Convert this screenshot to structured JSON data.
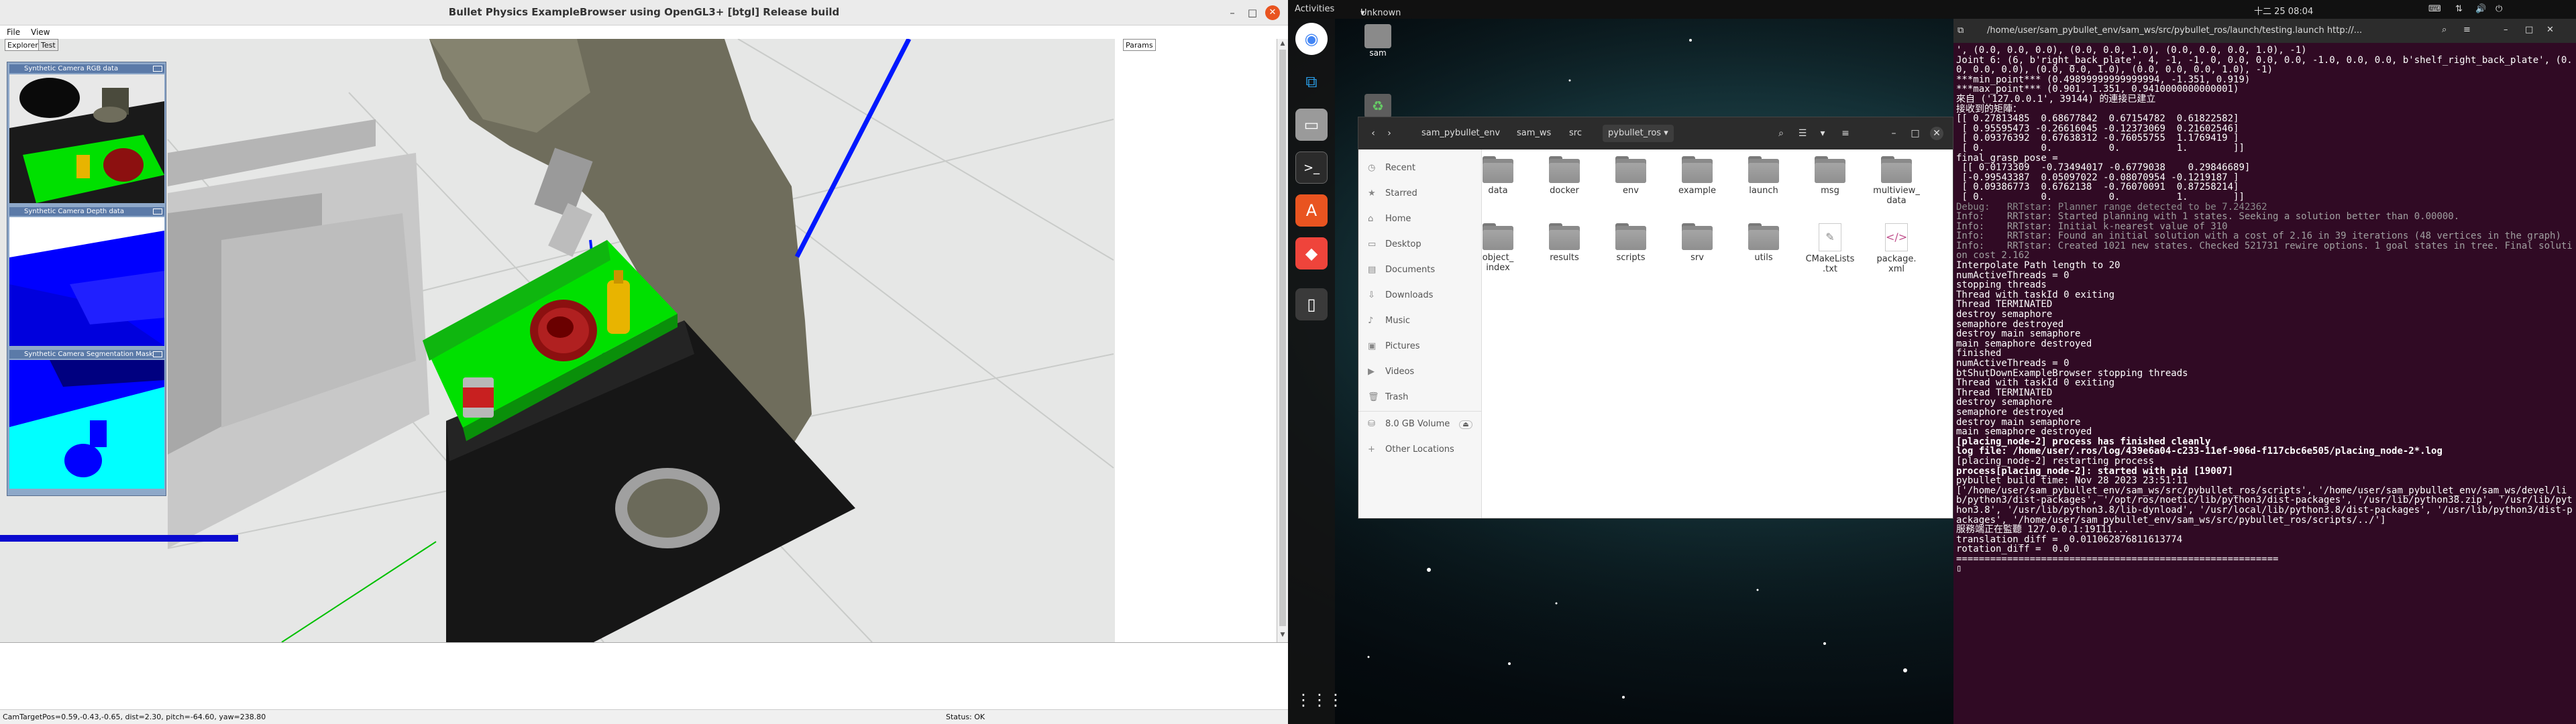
{
  "bullet": {
    "title": "Bullet Physics ExampleBrowser using OpenGL3+ [btgl] Release build",
    "menu": [
      "File",
      "View"
    ],
    "tabs": [
      "Explorer",
      "Test"
    ],
    "params_tab": "Params",
    "camera_panels": [
      "Synthetic Camera RGB data",
      "Synthetic Camera Depth data",
      "Synthetic Camera Segmentation Mask"
    ],
    "status_left": "CamTargetPos=0.59,-0.43,-0.65, dist=2.30, pitch=-64.60, yaw=238.80",
    "status_right": "Status: OK"
  },
  "topbar": {
    "activities": "Activities",
    "app_menu": "Unknown",
    "clock": "十二 25 08:04"
  },
  "dock": [
    {
      "name": "chrome",
      "icon": "chrome-icon"
    },
    {
      "name": "vscode",
      "icon": "vscode-icon"
    },
    {
      "name": "files",
      "icon": "files-icon"
    },
    {
      "name": "terminal",
      "icon": "terminal-icon"
    },
    {
      "name": "software",
      "icon": "software-icon"
    },
    {
      "name": "anydesk",
      "icon": "anydesk-icon"
    },
    {
      "name": "usb",
      "icon": "usb-icon"
    },
    {
      "name": "apps",
      "icon": "grid-icon"
    }
  ],
  "desktop_icons": {
    "home_label": "sam"
  },
  "files": {
    "breadcrumbs": [
      "sam_pybullet_env",
      "sam_ws",
      "src",
      "pybullet_ros"
    ],
    "sidebar": [
      "Recent",
      "Starred",
      "Home",
      "Desktop",
      "Documents",
      "Downloads",
      "Music",
      "Pictures",
      "Videos",
      "Trash",
      "8.0 GB Volume",
      "Other Locations"
    ],
    "items_row1": [
      "data",
      "docker",
      "env",
      "example",
      "launch",
      "msg",
      "multiview_\ndata"
    ],
    "items_row2": [
      "object_\nindex",
      "results",
      "scripts",
      "srv",
      "utils",
      "CMakeLists\n.txt",
      "package.\nxml"
    ]
  },
  "terminal": {
    "title": "/home/user/sam_pybullet_env/sam_ws/src/pybullet_ros/launch/testing.launch http://...",
    "lines": [
      {
        "t": "', (0.0, 0.0, 0.0), (0.0, 0.0, 1.0), (0.0, 0.0, 0.0, 1.0), -1)",
        "c": ""
      },
      {
        "t": "Joint 6: (6, b'right_back_plate', 4, -1, -1, 0, 0.0, 0.0, 0.0, -1.0, 0.0, 0.0, b'shelf_right_back_plate', (0.0, 0.0, 0.0), (0.0, 0.0, 1.0), (0.0, 0.0, 0.0, 1.0), -1)",
        "c": ""
      },
      {
        "t": "***min_point*** (0.49899999999999994, -1.351, 0.919)",
        "c": ""
      },
      {
        "t": "***max_point*** (0.901, 1.351, 0.9410000000000001)",
        "c": ""
      },
      {
        "t": "來自 ('127.0.0.1', 39144) 的連接已建立",
        "c": ""
      },
      {
        "t": "接收到的矩陣：",
        "c": ""
      },
      {
        "t": "[[ 0.27813485  0.68677842  0.67154782  0.61822582]",
        "c": ""
      },
      {
        "t": " [ 0.95595473 -0.26616045 -0.12373069  0.21602546]",
        "c": ""
      },
      {
        "t": " [ 0.09376392  0.67638312 -0.76055755  1.1769419 ]",
        "c": ""
      },
      {
        "t": " [ 0.          0.          0.          1.        ]]",
        "c": ""
      },
      {
        "t": "final_grasp_pose =",
        "c": ""
      },
      {
        "t": " [[ 0.0173309  -0.73494017 -0.6779038    0.29846689]",
        "c": ""
      },
      {
        "t": " [-0.99543387  0.05097022 -0.08070954 -0.1219187 ]",
        "c": ""
      },
      {
        "t": " [ 0.09386773  0.6762138  -0.76070091  0.87258214]",
        "c": ""
      },
      {
        "t": " [ 0.          0.          0.          1.        ]]",
        "c": ""
      },
      {
        "t": "Debug:   RRTstar: Planner range detected to be 7.242362",
        "c": "dbg"
      },
      {
        "t": "Info:    RRTstar: Started planning with 1 states. Seeking a solution better than 0.00000.",
        "c": "info"
      },
      {
        "t": "Info:    RRTstar: Initial k-nearest value of 310",
        "c": "info"
      },
      {
        "t": "Info:    RRTstar: Found an initial solution with a cost of 2.16 in 39 iterations (48 vertices in the graph)",
        "c": "info"
      },
      {
        "t": "Info:    RRTstar: Created 1021 new states. Checked 521731 rewire options. 1 goal states in tree. Final solution cost 2.162",
        "c": "info"
      },
      {
        "t": "Interpolate Path length to 20",
        "c": ""
      },
      {
        "t": "numActiveThreads = 0",
        "c": ""
      },
      {
        "t": "stopping threads",
        "c": ""
      },
      {
        "t": "Thread with taskId 0 exiting",
        "c": ""
      },
      {
        "t": "Thread TERMINATED",
        "c": ""
      },
      {
        "t": "destroy semaphore",
        "c": ""
      },
      {
        "t": "semaphore destroyed",
        "c": ""
      },
      {
        "t": "destroy main semaphore",
        "c": ""
      },
      {
        "t": "main semaphore destroyed",
        "c": ""
      },
      {
        "t": "finished",
        "c": ""
      },
      {
        "t": "numActiveThreads = 0",
        "c": ""
      },
      {
        "t": "btShutDownExampleBrowser stopping threads",
        "c": ""
      },
      {
        "t": "Thread with taskId 0 exiting",
        "c": ""
      },
      {
        "t": "Thread TERMINATED",
        "c": ""
      },
      {
        "t": "destroy semaphore",
        "c": ""
      },
      {
        "t": "semaphore destroyed",
        "c": ""
      },
      {
        "t": "destroy main semaphore",
        "c": ""
      },
      {
        "t": "main semaphore destroyed",
        "c": ""
      },
      {
        "t": "[placing_node-2] process has finished cleanly",
        "c": "b"
      },
      {
        "t": "log file: /home/user/.ros/log/439e6a04-c233-11ef-906d-f117cbc6e505/placing_node-2*.log",
        "c": "b"
      },
      {
        "t": "[placing_node-2] restarting process",
        "c": ""
      },
      {
        "t": "process[placing_node-2]: started with pid [19007]",
        "c": "b"
      },
      {
        "t": "pybullet build time: Nov 28 2023 23:51:11",
        "c": ""
      },
      {
        "t": "['/home/user/sam_pybullet_env/sam_ws/src/pybullet_ros/scripts', '/home/user/sam_pybullet_env/sam_ws/devel/lib/python3/dist-packages', '/opt/ros/noetic/lib/python3/dist-packages', '/usr/lib/python38.zip', '/usr/lib/python3.8', '/usr/lib/python3.8/lib-dynload', '/usr/local/lib/python3.8/dist-packages', '/usr/lib/python3/dist-packages', '/home/user/sam_pybullet_env/sam_ws/src/pybullet_ros/scripts/../']",
        "c": ""
      },
      {
        "t": "服務端正在監聽 127.0.0.1:19111...",
        "c": ""
      },
      {
        "t": "translation_diff =  0.011062876811613774",
        "c": ""
      },
      {
        "t": "rotation_diff =  0.0",
        "c": ""
      },
      {
        "t": "=========================================================",
        "c": ""
      },
      {
        "t": "▯",
        "c": ""
      }
    ]
  }
}
